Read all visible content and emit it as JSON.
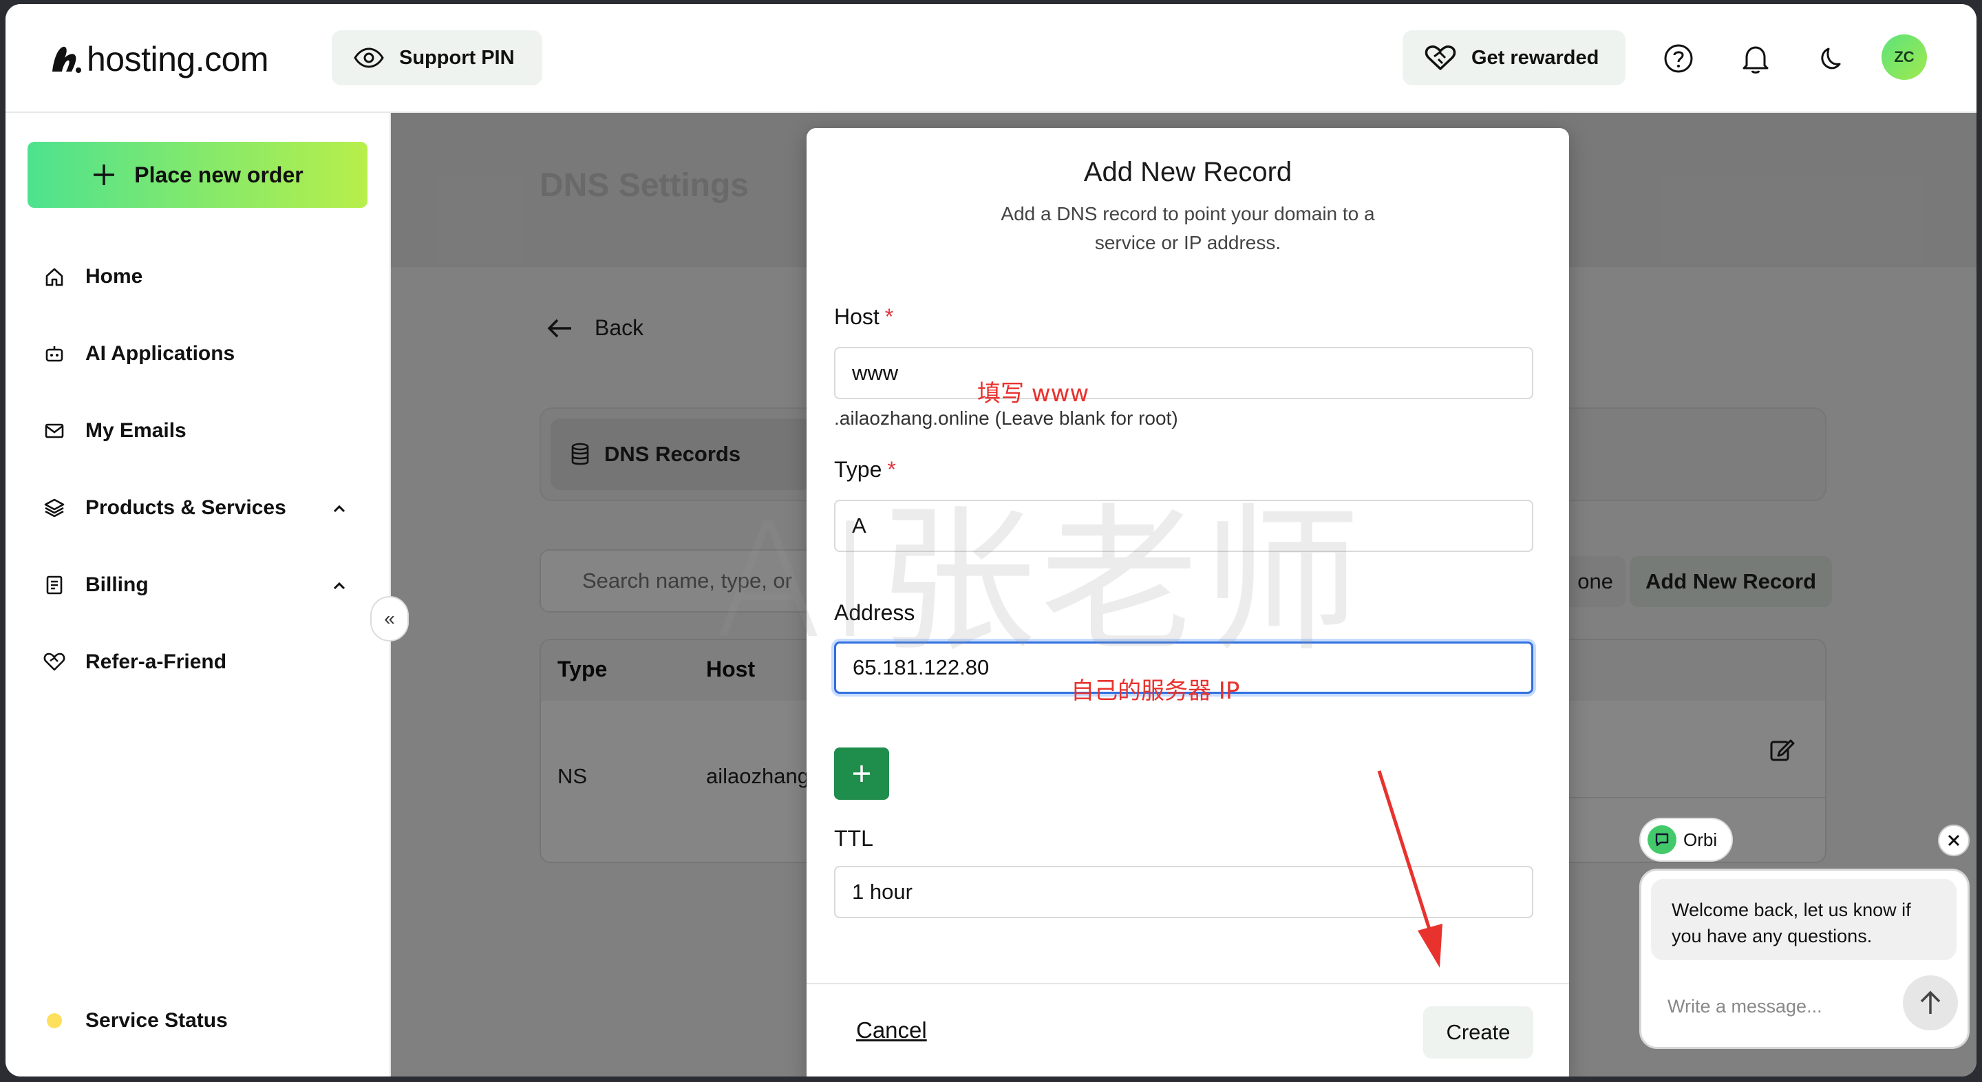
{
  "header": {
    "logo_text": "hosting.com",
    "support_pin_label": "Support PIN",
    "get_rewarded_label": "Get rewarded",
    "avatar_initials": "ZC"
  },
  "sidebar": {
    "place_order_label": "Place new order",
    "items": [
      {
        "label": "Home",
        "icon": "home-icon"
      },
      {
        "label": "AI Applications",
        "icon": "robot-icon"
      },
      {
        "label": "My Emails",
        "icon": "mail-icon"
      },
      {
        "label": "Products & Services",
        "icon": "layers-icon"
      },
      {
        "label": "Billing",
        "icon": "receipt-icon"
      },
      {
        "label": "Refer-a-Friend",
        "icon": "heart-handshake-icon"
      }
    ],
    "service_status_label": "Service Status",
    "collapse_glyph": "«"
  },
  "main": {
    "title": "DNS Settings",
    "back_label": "Back",
    "tab_dns_records": "DNS Records",
    "search_placeholder": "Search name, type, or",
    "zone_button_partial": "one",
    "add_new_record_label": "Add New Record",
    "table": {
      "headers": [
        "Type",
        "Host"
      ],
      "rows": [
        {
          "type": "NS",
          "host": "ailaozhang"
        }
      ]
    }
  },
  "modal": {
    "title": "Add New Record",
    "description": "Add a DNS record to point your domain to a service or IP address.",
    "host_label": "Host",
    "host_value": "www",
    "host_hint": ".ailaozhang.online (Leave blank for root)",
    "type_label": "Type",
    "type_value": "A",
    "address_label": "Address",
    "address_value": "65.181.122.80",
    "ttl_label": "TTL",
    "ttl_value": "1 hour",
    "required_mark": "*",
    "cancel_label": "Cancel",
    "create_label": "Create"
  },
  "annotations": {
    "host_note": "填写 www",
    "address_note": "自己的服务器 IP",
    "watermark": "AI张老师",
    "color": "#e8322e"
  },
  "chat": {
    "agent_name": "Orbi",
    "message": "Welcome back, let us know if you have any questions.",
    "input_placeholder": "Write a message..."
  },
  "colors": {
    "accent_green": "#1f8d4b",
    "gradient_start": "#4de28f",
    "gradient_end": "#b8ef4a",
    "focus_blue": "#2f6fe0"
  }
}
